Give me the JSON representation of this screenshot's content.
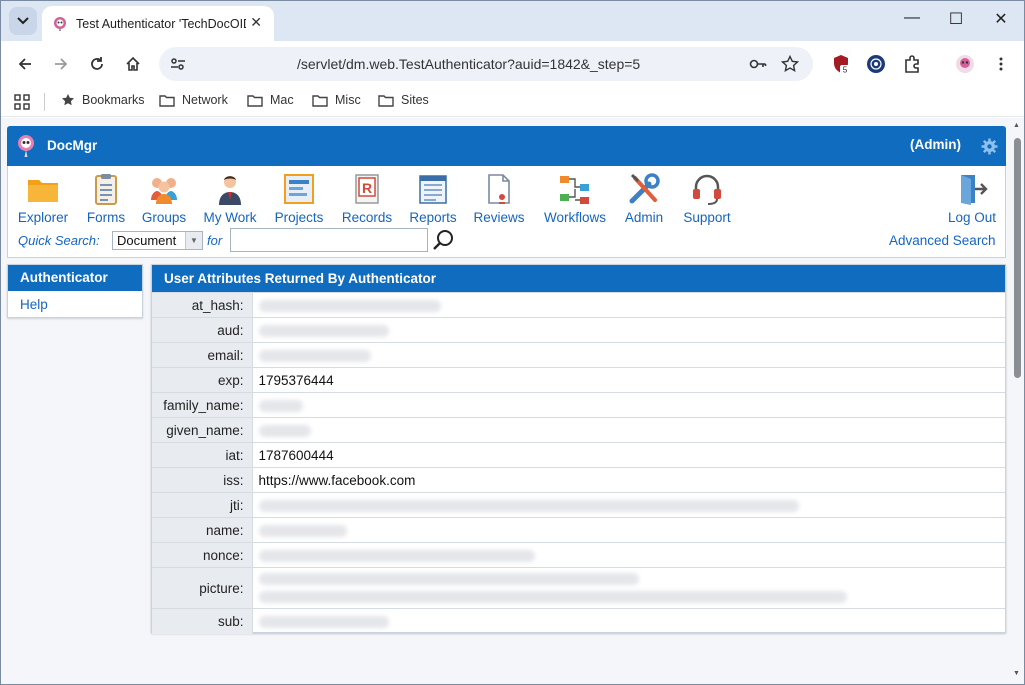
{
  "browser": {
    "tab_title": "Test Authenticator 'TechDocOIDC",
    "url": "/servlet/dm.web.TestAuthenticator?auid=1842&_step=5",
    "extension_badge": "5",
    "bookmarks": [
      "Bookmarks",
      "Network",
      "Mac",
      "Misc",
      "Sites"
    ]
  },
  "app": {
    "name": "DocMgr",
    "user_role": "(Admin)",
    "nav": [
      {
        "label": "Explorer",
        "icon": "folder-icon"
      },
      {
        "label": "Forms",
        "icon": "clipboard-icon"
      },
      {
        "label": "Groups",
        "icon": "group-icon"
      },
      {
        "label": "My Work",
        "icon": "person-icon"
      },
      {
        "label": "Projects",
        "icon": "projects-icon"
      },
      {
        "label": "Records",
        "icon": "records-icon"
      },
      {
        "label": "Reports",
        "icon": "reports-icon"
      },
      {
        "label": "Reviews",
        "icon": "reviews-icon"
      },
      {
        "label": "Workflows",
        "icon": "workflows-icon"
      },
      {
        "label": "Admin",
        "icon": "tools-icon"
      },
      {
        "label": "Support",
        "icon": "headset-icon"
      }
    ],
    "logout_label": "Log Out",
    "quick_search": {
      "label": "Quick Search:",
      "type_value": "Document",
      "for_label": "for",
      "query": ""
    },
    "advanced_search_label": "Advanced Search"
  },
  "sidebar": {
    "title": "Authenticator",
    "items": [
      "Help"
    ]
  },
  "panel": {
    "title": "User Attributes Returned By Authenticator",
    "rows": [
      {
        "key": "at_hash:",
        "value": "",
        "redacted": true
      },
      {
        "key": "aud:",
        "value": "",
        "redacted": true
      },
      {
        "key": "email:",
        "value": "",
        "redacted": true
      },
      {
        "key": "exp:",
        "value": "1795376444",
        "redacted": false
      },
      {
        "key": "family_name:",
        "value": "",
        "redacted": true
      },
      {
        "key": "given_name:",
        "value": "",
        "redacted": true
      },
      {
        "key": "iat:",
        "value": "1787600444",
        "redacted": false
      },
      {
        "key": "iss:",
        "value": "https://www.facebook.com",
        "redacted": false
      },
      {
        "key": "jti:",
        "value": "",
        "redacted": true
      },
      {
        "key": "name:",
        "value": "",
        "redacted": true
      },
      {
        "key": "nonce:",
        "value": "",
        "redacted": true
      },
      {
        "key": "picture:",
        "value": "",
        "redacted": true
      },
      {
        "key": "sub:",
        "value": "",
        "redacted": true
      }
    ]
  },
  "colors": {
    "brand_blue": "#0f6cbf",
    "link_blue": "#1565c0",
    "key_cell_bg": "#e8ebef"
  }
}
